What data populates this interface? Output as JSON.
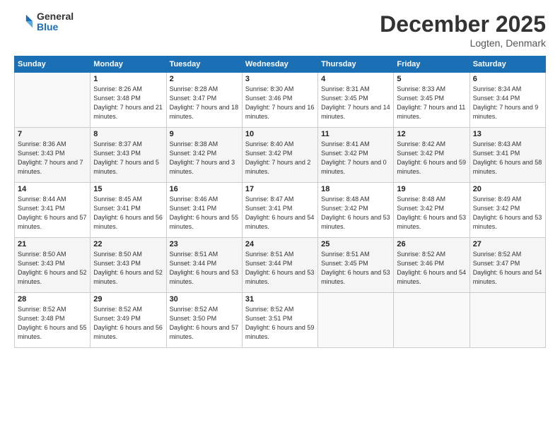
{
  "logo": {
    "general": "General",
    "blue": "Blue"
  },
  "title": "December 2025",
  "location": "Logten, Denmark",
  "days_of_week": [
    "Sunday",
    "Monday",
    "Tuesday",
    "Wednesday",
    "Thursday",
    "Friday",
    "Saturday"
  ],
  "weeks": [
    [
      {
        "day": "",
        "empty": true
      },
      {
        "day": "1",
        "sunrise": "8:26 AM",
        "sunset": "3:48 PM",
        "daylight": "7 hours and 21 minutes."
      },
      {
        "day": "2",
        "sunrise": "8:28 AM",
        "sunset": "3:47 PM",
        "daylight": "7 hours and 18 minutes."
      },
      {
        "day": "3",
        "sunrise": "8:30 AM",
        "sunset": "3:46 PM",
        "daylight": "7 hours and 16 minutes."
      },
      {
        "day": "4",
        "sunrise": "8:31 AM",
        "sunset": "3:45 PM",
        "daylight": "7 hours and 14 minutes."
      },
      {
        "day": "5",
        "sunrise": "8:33 AM",
        "sunset": "3:45 PM",
        "daylight": "7 hours and 11 minutes."
      },
      {
        "day": "6",
        "sunrise": "8:34 AM",
        "sunset": "3:44 PM",
        "daylight": "7 hours and 9 minutes."
      }
    ],
    [
      {
        "day": "7",
        "sunrise": "8:36 AM",
        "sunset": "3:43 PM",
        "daylight": "7 hours and 7 minutes."
      },
      {
        "day": "8",
        "sunrise": "8:37 AM",
        "sunset": "3:43 PM",
        "daylight": "7 hours and 5 minutes."
      },
      {
        "day": "9",
        "sunrise": "8:38 AM",
        "sunset": "3:42 PM",
        "daylight": "7 hours and 3 minutes."
      },
      {
        "day": "10",
        "sunrise": "8:40 AM",
        "sunset": "3:42 PM",
        "daylight": "7 hours and 2 minutes."
      },
      {
        "day": "11",
        "sunrise": "8:41 AM",
        "sunset": "3:42 PM",
        "daylight": "7 hours and 0 minutes."
      },
      {
        "day": "12",
        "sunrise": "8:42 AM",
        "sunset": "3:42 PM",
        "daylight": "6 hours and 59 minutes."
      },
      {
        "day": "13",
        "sunrise": "8:43 AM",
        "sunset": "3:41 PM",
        "daylight": "6 hours and 58 minutes."
      }
    ],
    [
      {
        "day": "14",
        "sunrise": "8:44 AM",
        "sunset": "3:41 PM",
        "daylight": "6 hours and 57 minutes."
      },
      {
        "day": "15",
        "sunrise": "8:45 AM",
        "sunset": "3:41 PM",
        "daylight": "6 hours and 56 minutes."
      },
      {
        "day": "16",
        "sunrise": "8:46 AM",
        "sunset": "3:41 PM",
        "daylight": "6 hours and 55 minutes."
      },
      {
        "day": "17",
        "sunrise": "8:47 AM",
        "sunset": "3:41 PM",
        "daylight": "6 hours and 54 minutes."
      },
      {
        "day": "18",
        "sunrise": "8:48 AM",
        "sunset": "3:42 PM",
        "daylight": "6 hours and 53 minutes."
      },
      {
        "day": "19",
        "sunrise": "8:48 AM",
        "sunset": "3:42 PM",
        "daylight": "6 hours and 53 minutes."
      },
      {
        "day": "20",
        "sunrise": "8:49 AM",
        "sunset": "3:42 PM",
        "daylight": "6 hours and 53 minutes."
      }
    ],
    [
      {
        "day": "21",
        "sunrise": "8:50 AM",
        "sunset": "3:43 PM",
        "daylight": "6 hours and 52 minutes."
      },
      {
        "day": "22",
        "sunrise": "8:50 AM",
        "sunset": "3:43 PM",
        "daylight": "6 hours and 52 minutes."
      },
      {
        "day": "23",
        "sunrise": "8:51 AM",
        "sunset": "3:44 PM",
        "daylight": "6 hours and 53 minutes."
      },
      {
        "day": "24",
        "sunrise": "8:51 AM",
        "sunset": "3:44 PM",
        "daylight": "6 hours and 53 minutes."
      },
      {
        "day": "25",
        "sunrise": "8:51 AM",
        "sunset": "3:45 PM",
        "daylight": "6 hours and 53 minutes."
      },
      {
        "day": "26",
        "sunrise": "8:52 AM",
        "sunset": "3:46 PM",
        "daylight": "6 hours and 54 minutes."
      },
      {
        "day": "27",
        "sunrise": "8:52 AM",
        "sunset": "3:47 PM",
        "daylight": "6 hours and 54 minutes."
      }
    ],
    [
      {
        "day": "28",
        "sunrise": "8:52 AM",
        "sunset": "3:48 PM",
        "daylight": "6 hours and 55 minutes."
      },
      {
        "day": "29",
        "sunrise": "8:52 AM",
        "sunset": "3:49 PM",
        "daylight": "6 hours and 56 minutes."
      },
      {
        "day": "30",
        "sunrise": "8:52 AM",
        "sunset": "3:50 PM",
        "daylight": "6 hours and 57 minutes."
      },
      {
        "day": "31",
        "sunrise": "8:52 AM",
        "sunset": "3:51 PM",
        "daylight": "6 hours and 59 minutes."
      },
      {
        "day": "",
        "empty": true
      },
      {
        "day": "",
        "empty": true
      },
      {
        "day": "",
        "empty": true
      }
    ]
  ]
}
